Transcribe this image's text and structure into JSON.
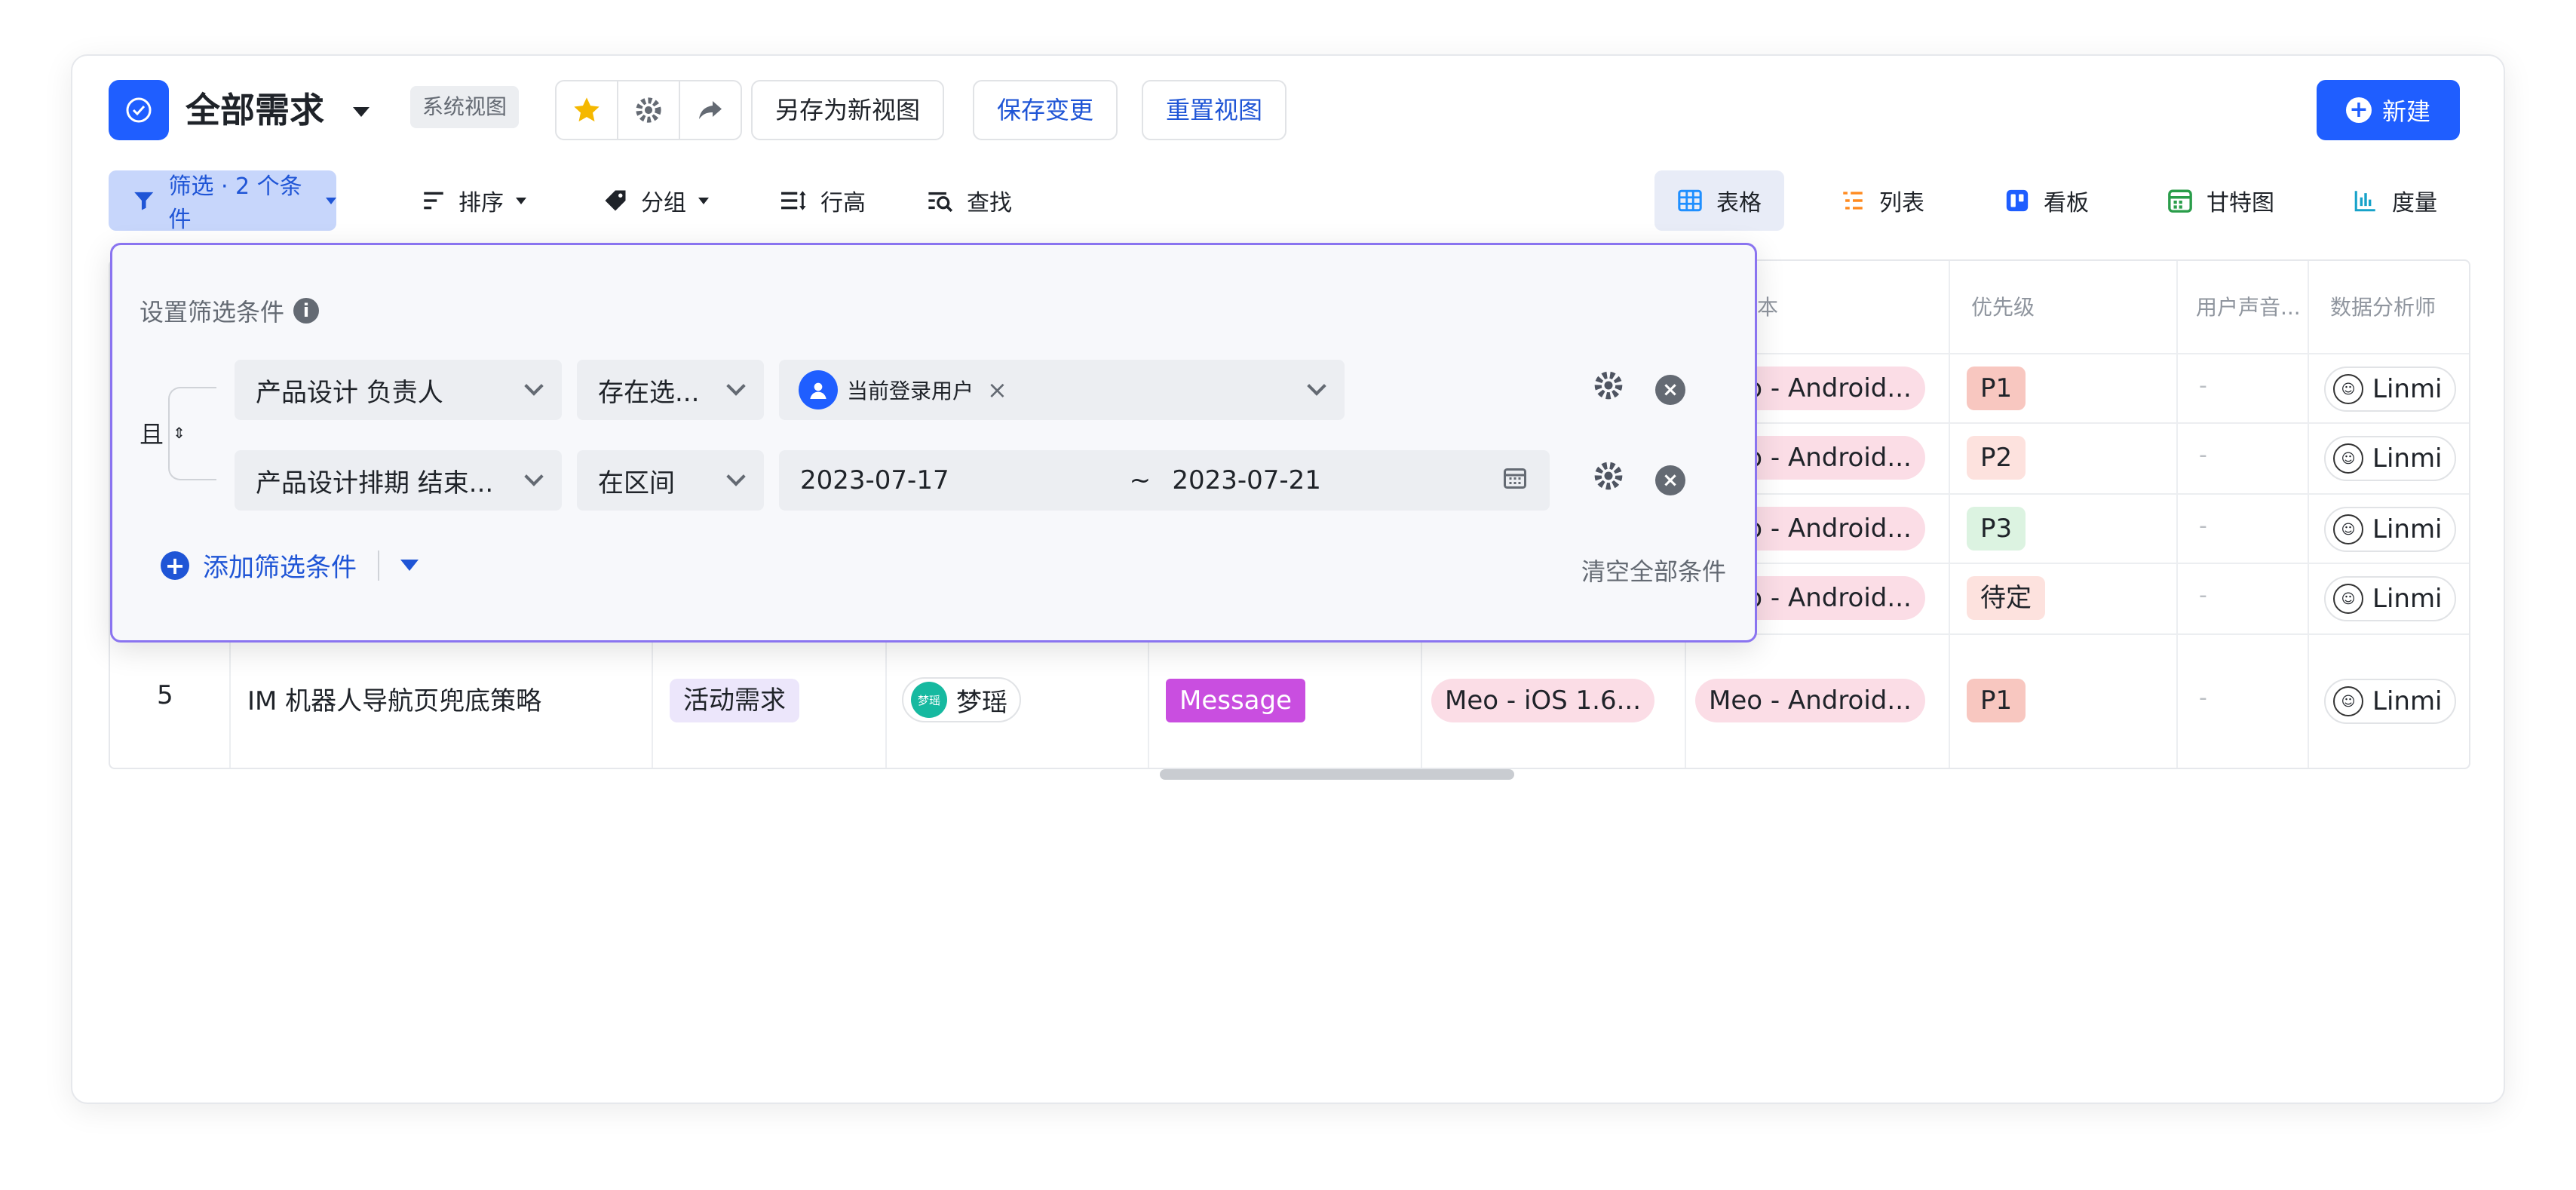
{
  "header": {
    "title": "全部需求",
    "system_badge": "系统视图",
    "save_as_new": "另存为新视图",
    "save_changes": "保存变更",
    "reset_view": "重置视图",
    "new_button": "新建"
  },
  "toolbar": {
    "filter": "筛选 · 2 个条件",
    "sort": "排序",
    "group": "分组",
    "row_height": "行高",
    "find": "查找",
    "views": {
      "table": "表格",
      "list": "列表",
      "board": "看板",
      "gantt": "甘特图",
      "metric": "度量"
    }
  },
  "table": {
    "headers": {
      "plan_version": "划版本",
      "priority": "优先级",
      "user_voice": "用户声音...",
      "analyst": "数据分析师"
    },
    "rows": [
      {
        "android": "Meo - Android...",
        "priority": "P1",
        "voice": "-",
        "analyst": "Linmi"
      },
      {
        "android": "Meo - Android...",
        "priority": "P2",
        "voice": "-",
        "analyst": "Linmi"
      },
      {
        "android": "Meo - Android...",
        "priority": "P3",
        "voice": "-",
        "analyst": "Linmi"
      },
      {
        "android": "Meo - Android...",
        "priority": "待定",
        "voice": "-",
        "analyst": "Linmi"
      },
      {
        "num": "5",
        "title": "IM 机器人导航页兜底策略",
        "type": "活动需求",
        "owner_avatar": "梦瑶",
        "owner": "梦瑶",
        "module": "Message",
        "ios": "Meo - iOS 1.6...",
        "android": "Meo - Android...",
        "priority": "P1",
        "voice": "-",
        "analyst": "Linmi"
      }
    ]
  },
  "filter_popup": {
    "title": "设置筛选条件",
    "conjunction": "且",
    "conditions": [
      {
        "field": "产品设计 负责人",
        "operator": "存在选...",
        "value": "当前登录用户"
      },
      {
        "field": "产品设计排期 结束...",
        "operator": "在区间",
        "start": "2023-07-17",
        "separator": "~",
        "end": "2023-07-21"
      }
    ],
    "add_condition": "添加筛选条件",
    "clear_all": "清空全部条件"
  },
  "colors": {
    "accent": "#1f5eff",
    "popup_border": "#8a74f0",
    "p1": "#f8c7c0",
    "p2": "#fde2de",
    "p3": "#dcf3e1",
    "pending": "#fde2de",
    "activity": "#ece6fb",
    "message": "#c94ee0"
  }
}
